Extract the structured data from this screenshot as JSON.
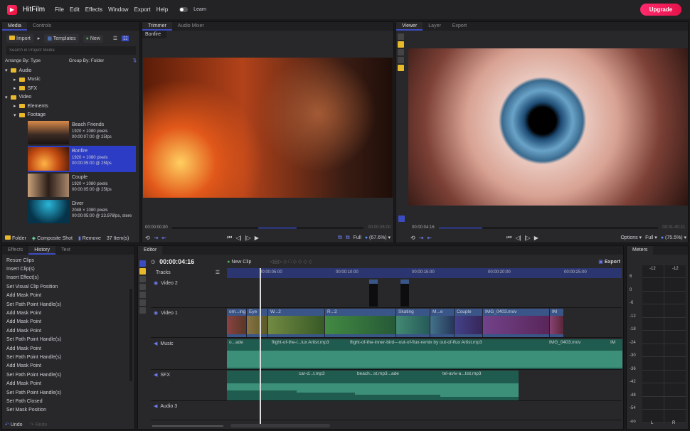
{
  "app": {
    "name": "HitFilm",
    "menu": [
      "File",
      "Edit",
      "Effects",
      "Window",
      "Export",
      "Help"
    ],
    "learn": "Learn",
    "upgrade": "Upgrade",
    "accent": "#3b4cc0",
    "brand_color": "#ff2a6d"
  },
  "media": {
    "tabs": [
      "Media",
      "Controls"
    ],
    "import": "Import",
    "templates": "Templates",
    "new": "New",
    "search_placeholder": "Search in Project Media",
    "arrange": "Arrange By: Type",
    "group": "Group By: Folder",
    "tree": [
      "Audio",
      "Music",
      "SFX",
      "Video",
      "Elements",
      "Footage"
    ],
    "items": [
      {
        "name": "Beach Friends",
        "res": "1920 × 1080 pixels",
        "dur": "00:00:07:00 @ 25fps"
      },
      {
        "name": "Bonfire",
        "res": "1920 × 1080 pixels",
        "dur": "00:00:05:00 @ 25fps"
      },
      {
        "name": "Couple",
        "res": "1920 × 1080 pixels",
        "dur": "00:00:05:00 @ 25fps"
      },
      {
        "name": "Diver",
        "res": "2048 × 1080 pixels",
        "dur": "00:00:05:00 @ 23.976fps, stere"
      }
    ],
    "footer": {
      "folder": "Folder",
      "composite": "Composite Shot",
      "remove": "Remove",
      "count": "37 Item(s)"
    }
  },
  "trimmer": {
    "tabs": [
      "Trimmer",
      "Audio Mixer"
    ],
    "clip": "Bonfire",
    "time_start": "00:00:00:00",
    "time_end": "00:00:05:00",
    "quality": "Full",
    "zoom": "(67.6%)"
  },
  "viewer": {
    "tabs": [
      "Viewer",
      "Layer",
      "Export"
    ],
    "time": "00:00:04:16",
    "time_end": "00:01:40:21",
    "options": "Options",
    "quality": "Full",
    "zoom": "(75.5%)"
  },
  "history": {
    "tabs": [
      "Effects",
      "History",
      "Text"
    ],
    "items": [
      "Resize Clips",
      "Insert Clip(s)",
      "Insert Effect(s)",
      "Set Visual Clip Position",
      "Add Mask Point",
      "Set Path Point Handle(s)",
      "Add Mask Point",
      "Add Mask Point",
      "Add Mask Point",
      "Set Path Point Handle(s)",
      "Add Mask Point",
      "Set Path Point Handle(s)",
      "Add Mask Point",
      "Set Path Point Handle(s)",
      "Add Mask Point",
      "Set Path Point Handle(s)",
      "Set Path Closed",
      "Set Mask Position"
    ],
    "undo": "Undo",
    "redo": "Redo"
  },
  "editor": {
    "tab": "Editor",
    "timecode": "00:00:04:16",
    "new_clip": "New Clip",
    "export": "Export",
    "tracks_label": "Tracks",
    "ruler": [
      "00:00:05:00",
      "00:00:10:00",
      "00:00:15:00",
      "00:00:20:00",
      "00:00:25:00"
    ],
    "tracks": [
      "Video 2",
      "Video 1",
      "Music",
      "SFX",
      "Audio 3"
    ],
    "video1_clips": [
      "om...ing",
      "Eye",
      "W...2",
      "R...2",
      "Skating",
      "M...e",
      "Couple",
      "IMG_0403.mov",
      "IM"
    ],
    "music_clips": [
      "o...ade",
      "flight-of-the-i...lux Artist.mp3",
      "flight-of-the-inner-bird---out-of-flux-remix by out-of-flux Artist.mp3",
      "IMG_0403.mov",
      "IM"
    ],
    "sfx_clips": [
      "car-d...t.mp3",
      "beach...st.mp3...ade",
      "tel-aviv-a...tist.mp3"
    ]
  },
  "meters": {
    "tab": "Meters",
    "peaks": [
      "-12",
      "-12"
    ],
    "scale": [
      "6",
      "0",
      "-6",
      "-12",
      "-18",
      "-24",
      "-30",
      "-36",
      "-42",
      "-48",
      "-54",
      "-oo"
    ],
    "channels": [
      "L",
      "R"
    ]
  }
}
